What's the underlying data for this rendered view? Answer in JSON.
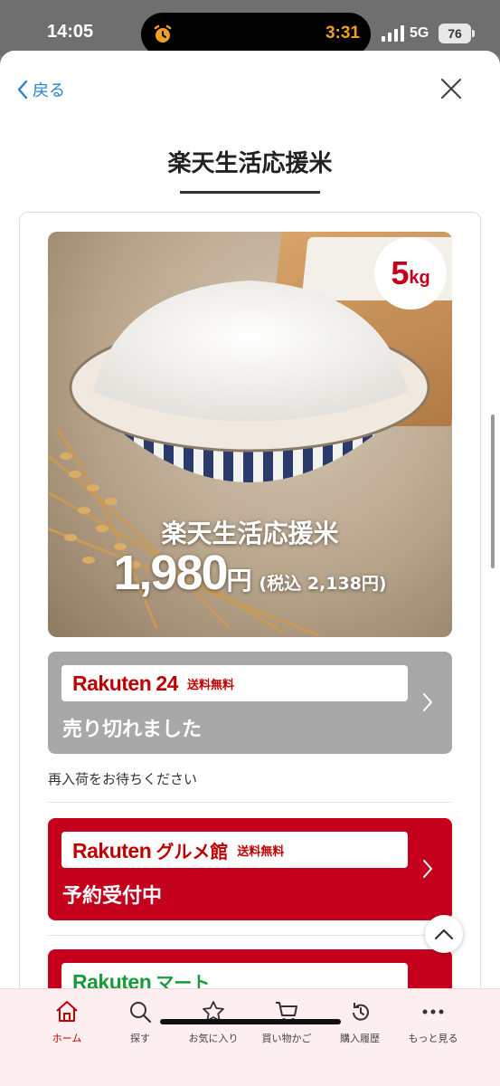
{
  "status_bar": {
    "time": "14:05",
    "island_time": "3:31",
    "network": "5G",
    "battery": "76"
  },
  "nav": {
    "back_label": "戻る"
  },
  "page_title": "楽天生活応援米",
  "hero": {
    "weight_number": "5",
    "weight_unit": "kg",
    "product_name": "楽天生活応援米",
    "price": "1,980",
    "yen": "円",
    "tax_price": "(税込 2,138円)"
  },
  "shops": [
    {
      "logo": "Rakuten",
      "sub": "24",
      "shipping": "送料無料",
      "status": "売り切れました",
      "state": "sold-out"
    },
    {
      "logo": "Rakuten",
      "sub": "グルメ館",
      "shipping": "送料無料",
      "status": "予約受付中",
      "state": "available"
    },
    {
      "logo": "Rakuten",
      "sub": "マート"
    }
  ],
  "restock_note": "再入荷をお待ちください",
  "tab_bar": [
    {
      "label": "ホーム",
      "icon": "home-icon",
      "active": true
    },
    {
      "label": "探す",
      "icon": "search-icon"
    },
    {
      "label": "お気に入り",
      "icon": "star-icon"
    },
    {
      "label": "買い物かご",
      "icon": "cart-icon"
    },
    {
      "label": "購入履歴",
      "icon": "history-icon"
    },
    {
      "label": "もっと見る",
      "icon": "more-icon"
    }
  ],
  "colors": {
    "brand_red": "#bf0000",
    "card_red": "#c4001c",
    "sold_out_gray": "#a8a8a8",
    "link_blue": "#2a82c8",
    "mart_green": "#1a9a3a"
  }
}
